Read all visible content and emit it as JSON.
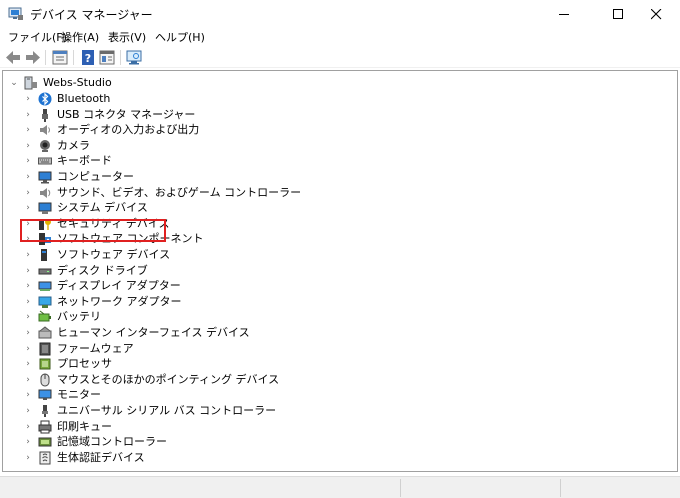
{
  "window": {
    "title": "デバイス マネージャー",
    "controls": {
      "minimize_icon": "minimize-icon",
      "maximize_icon": "maximize-icon",
      "close_icon": "close-icon"
    }
  },
  "menu": [
    {
      "label": "ファイル(F)"
    },
    {
      "label": "操作(A)"
    },
    {
      "label": "表示(V)"
    },
    {
      "label": "ヘルプ(H)"
    }
  ],
  "toolbar": {
    "buttons": [
      "back-arrow-icon",
      "forward-arrow-icon",
      "properties-icon",
      "help-icon",
      "view-icon",
      "monitor-scan-icon"
    ]
  },
  "tree": {
    "root": {
      "label": "Webs-Studio",
      "icon": "computer-root-icon",
      "expanded": true
    },
    "items": [
      {
        "label": "Bluetooth",
        "icon": "bluetooth-icon"
      },
      {
        "label": "USB コネクタ マネージャー",
        "icon": "usb-connector-icon"
      },
      {
        "label": "オーディオの入力および出力",
        "icon": "speaker-icon"
      },
      {
        "label": "カメラ",
        "icon": "camera-icon"
      },
      {
        "label": "キーボード",
        "icon": "keyboard-icon"
      },
      {
        "label": "コンピューター",
        "icon": "computer-icon"
      },
      {
        "label": "サウンド、ビデオ、およびゲーム コントローラー",
        "icon": "sound-icon"
      },
      {
        "label": "システム デバイス",
        "icon": "system-device-icon"
      },
      {
        "label": "セキュリティ デバイス",
        "icon": "security-key-icon"
      },
      {
        "label": "ソフトウェア コンポーネント",
        "icon": "software-component-icon"
      },
      {
        "label": "ソフトウェア デバイス",
        "icon": "software-device-icon"
      },
      {
        "label": "ディスク ドライブ",
        "icon": "disk-drive-icon"
      },
      {
        "label": "ディスプレイ アダプター",
        "icon": "display-adapter-icon"
      },
      {
        "label": "ネットワーク アダプター",
        "icon": "network-adapter-icon",
        "highlighted": true
      },
      {
        "label": "バッテリ",
        "icon": "battery-icon"
      },
      {
        "label": "ヒューマン インターフェイス デバイス",
        "icon": "hid-icon"
      },
      {
        "label": "ファームウェア",
        "icon": "firmware-icon"
      },
      {
        "label": "プロセッサ",
        "icon": "processor-icon"
      },
      {
        "label": "マウスとそのほかのポインティング デバイス",
        "icon": "mouse-icon"
      },
      {
        "label": "モニター",
        "icon": "monitor-icon"
      },
      {
        "label": "ユニバーサル シリアル バス コントローラー",
        "icon": "usb-controller-icon"
      },
      {
        "label": "印刷キュー",
        "icon": "printer-icon"
      },
      {
        "label": "記憶域コントローラー",
        "icon": "storage-controller-icon"
      },
      {
        "label": "生体認証デバイス",
        "icon": "biometric-icon"
      }
    ]
  },
  "colors": {
    "highlight_border": "#e02020",
    "accent": "#1e73d2"
  }
}
